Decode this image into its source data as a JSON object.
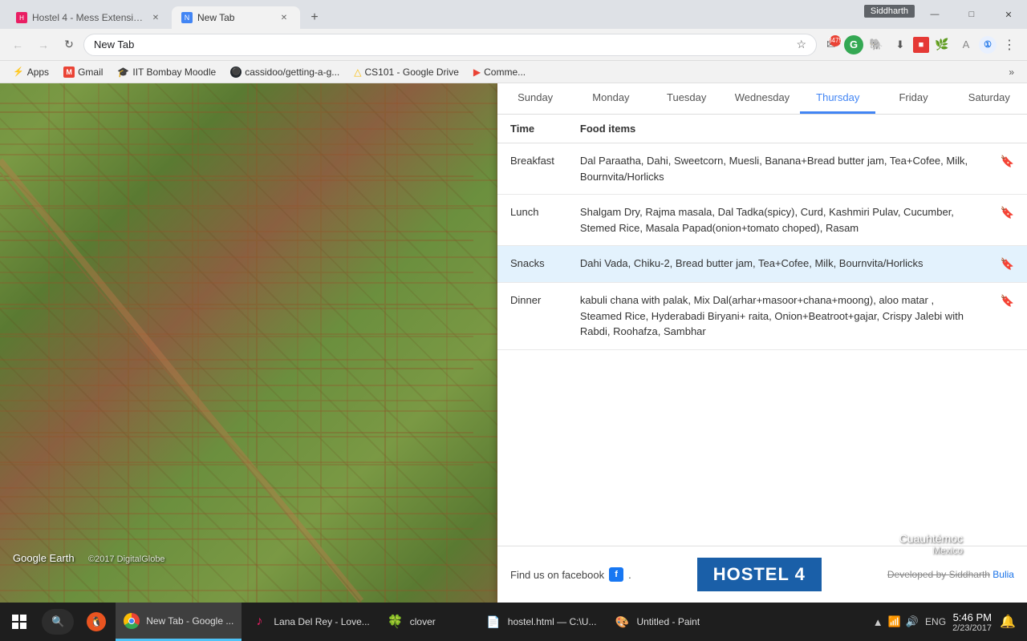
{
  "chrome": {
    "tabs": [
      {
        "label": "Hostel 4 - Mess Extensio...",
        "active": false,
        "favicon_color": "#e91e63"
      },
      {
        "label": "New Tab",
        "active": true,
        "favicon_color": "#4285f4"
      }
    ],
    "address": "New Tab",
    "siddharth_label": "Siddharth",
    "window_controls": [
      "—",
      "□",
      "✕"
    ],
    "bookmarks": [
      {
        "label": "Apps",
        "icon": "⚡"
      },
      {
        "label": "Gmail",
        "icon": "M"
      },
      {
        "label": "IIT Bombay Moodle",
        "icon": "🎓"
      },
      {
        "label": "cassidoo/getting-a-g...",
        "icon": "⚫"
      },
      {
        "label": "CS101 - Google Drive",
        "icon": "△"
      },
      {
        "label": "Comme...",
        "icon": "▶"
      }
    ]
  },
  "mess_panel": {
    "days": [
      "Sunday",
      "Monday",
      "Tuesday",
      "Wednesday",
      "Thursday",
      "Friday",
      "Saturday"
    ],
    "active_day": "Thursday",
    "table_headers": {
      "time": "Time",
      "food": "Food items"
    },
    "meals": [
      {
        "time": "Breakfast",
        "items": "Dal Paraatha, Dahi, Sweetcorn, Muesli, Banana+Bread butter jam, Tea+Cofee, Milk, Bournvita/Horlicks",
        "bookmarked": false,
        "highlighted": false
      },
      {
        "time": "Lunch",
        "items": "Shalgam Dry, Rajma masala, Dal Tadka(spicy), Curd, Kashmiri Pulav, Cucumber, Stemed Rice, Masala Papad(onion+tomato choped), Rasam",
        "bookmarked": false,
        "highlighted": false
      },
      {
        "time": "Snacks",
        "items": "Dahi Vada, Chiku-2, Bread butter jam, Tea+Cofee, Milk, Bournvita/Horlicks",
        "bookmarked": true,
        "highlighted": true
      },
      {
        "time": "Dinner",
        "items": "kabuli chana with palak, Mix Dal(arhar+masoor+chana+moong), aloo matar , Steamed Rice, Hyderabadi Biryani+ raita, Onion+Beatroot+gajar, Crispy Jalebi with Rabdi, Roohafza, Sambhar",
        "bookmarked": false,
        "highlighted": false
      }
    ],
    "footer": {
      "find_facebook": "Find us on facebook",
      "hostel_logo": "HOSTEL 4",
      "dev_credit_prefix": "Developed by ",
      "dev_name_strike": "Siddharth",
      "dev_name_link": "Bulia"
    }
  },
  "taskbar": {
    "items": [
      {
        "label": "New Tab - Google ...",
        "icon": "chrome",
        "active": true
      },
      {
        "label": "Lana Del Rey - Love...",
        "icon": "music",
        "active": false
      },
      {
        "label": "clover",
        "icon": "clover",
        "active": false
      },
      {
        "label": "hostel.html — C:\\U...",
        "icon": "file",
        "active": false
      },
      {
        "label": "Untitled - Paint",
        "icon": "paint",
        "active": false
      }
    ],
    "clock": {
      "time": "5:46 PM",
      "date": "2/23/2017"
    },
    "language": "ENG"
  },
  "map": {
    "location": "Cuauhtémoc",
    "country": "Mexico",
    "google_earth": "Google Earth",
    "copyright": "©2017 DigitalGlobe"
  }
}
